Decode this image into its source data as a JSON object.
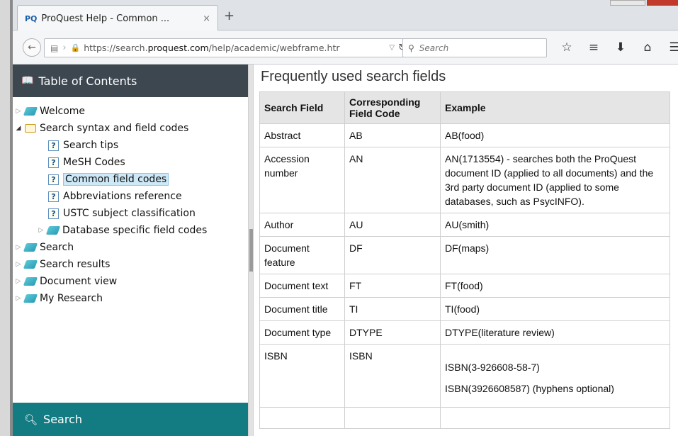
{
  "browser": {
    "tab_title": "ProQuest Help - Common ...",
    "tab_favicon": "PQ",
    "tab_close": "×",
    "new_tab": "+",
    "url_prefix": "https://search.",
    "url_domain": "proquest.com",
    "url_path": "/help/academic/webframe.htr",
    "search_placeholder": "Search",
    "icons": [
      "star-icon",
      "reading-list-icon",
      "download-icon",
      "home-icon",
      "menu-icon"
    ]
  },
  "toc": {
    "header": "Table of Contents",
    "items": [
      {
        "label": "Welcome"
      },
      {
        "label": "Search syntax and field codes"
      },
      {
        "label": "Search tips"
      },
      {
        "label": "MeSH Codes"
      },
      {
        "label": "Common field codes"
      },
      {
        "label": "Abbreviations reference"
      },
      {
        "label": "USTC subject classification"
      },
      {
        "label": "Database specific field codes"
      },
      {
        "label": "Search"
      },
      {
        "label": "Search results"
      },
      {
        "label": "Document view"
      },
      {
        "label": "My Research"
      }
    ],
    "footer_search": "Search"
  },
  "content": {
    "title": "Frequently used search fields",
    "headers": [
      "Search Field",
      "Corresponding Field Code",
      "Example"
    ],
    "rows": [
      {
        "field": "Abstract",
        "code": "AB",
        "example": "AB(food)"
      },
      {
        "field": "Accession number",
        "code": "AN",
        "example": "AN(1713554) - searches both the ProQuest document ID (applied to all documents) and the 3rd party document ID (applied to some databases, such as PsycINFO)."
      },
      {
        "field": "Author",
        "code": "AU",
        "example": "AU(smith)"
      },
      {
        "field": "Document feature",
        "code": "DF",
        "example": "DF(maps)"
      },
      {
        "field": "Document text",
        "code": "FT",
        "example": "FT(food)"
      },
      {
        "field": "Document title",
        "code": "TI",
        "example": "TI(food)"
      },
      {
        "field": "Document type",
        "code": "DTYPE",
        "example": "DTYPE(literature review)"
      },
      {
        "field": "ISBN",
        "code": "ISBN",
        "example": "ISBN(3-926608-58-7)",
        "example2": "ISBN(3926608587) (hyphens optional)"
      }
    ]
  }
}
